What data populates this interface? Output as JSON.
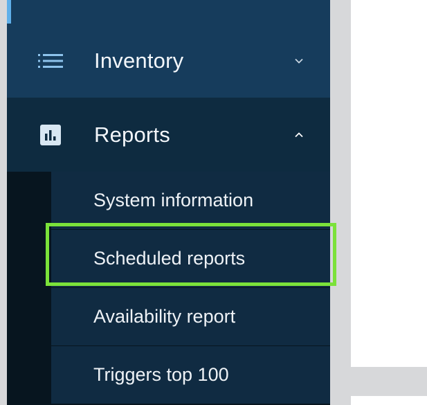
{
  "sidebar": {
    "menu": [
      {
        "label": "Inventory",
        "icon": "list-icon",
        "state": "collapsed"
      },
      {
        "label": "Reports",
        "icon": "bar-chart-icon",
        "state": "expanded"
      }
    ],
    "reports_submenu": [
      {
        "label": "System information"
      },
      {
        "label": "Scheduled reports",
        "highlighted": true
      },
      {
        "label": "Availability report"
      },
      {
        "label": "Triggers top 100"
      }
    ]
  },
  "colors": {
    "sidebar_bg": "#0c2233",
    "menu_row_bg": "#163c5c",
    "highlight_border": "#7be23a",
    "accent": "#5fb0ea"
  }
}
